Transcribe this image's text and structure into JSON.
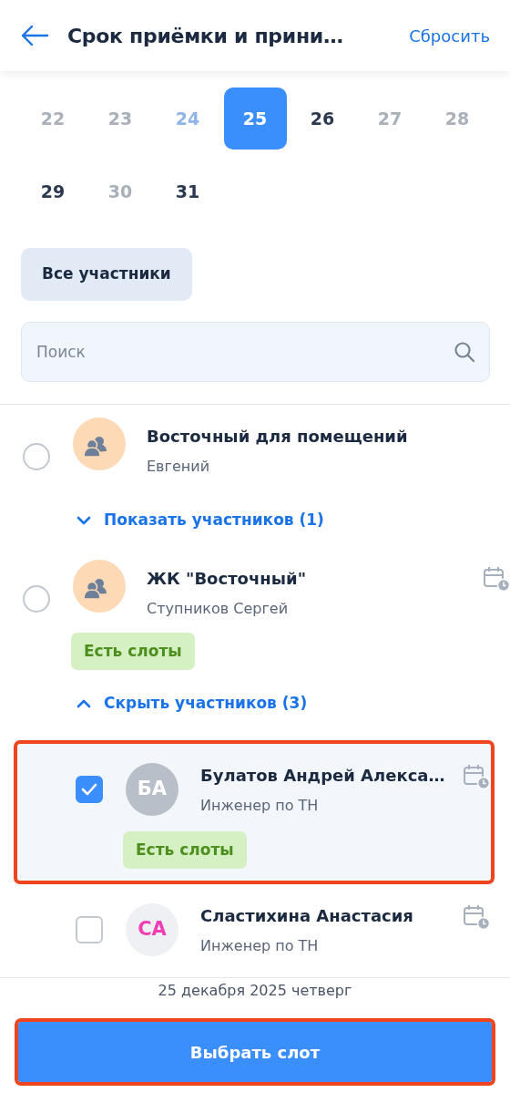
{
  "header": {
    "title": "Срок приёмки и прини…",
    "action": "Сбросить"
  },
  "calendar": {
    "weeks": [
      [
        {
          "label": "22",
          "disabled": true,
          "today": false,
          "selected": false
        },
        {
          "label": "23",
          "disabled": true,
          "today": false,
          "selected": false
        },
        {
          "label": "24",
          "disabled": true,
          "today": true,
          "selected": false
        },
        {
          "label": "25",
          "disabled": false,
          "today": false,
          "selected": true
        },
        {
          "label": "26",
          "disabled": false,
          "today": false,
          "selected": false
        },
        {
          "label": "27",
          "disabled": true,
          "today": false,
          "selected": false
        },
        {
          "label": "28",
          "disabled": true,
          "today": false,
          "selected": false
        }
      ],
      [
        {
          "label": "29",
          "disabled": false,
          "today": false,
          "selected": false
        },
        {
          "label": "30",
          "disabled": true,
          "today": false,
          "selected": false
        },
        {
          "label": "31",
          "disabled": false,
          "today": false,
          "selected": false
        }
      ]
    ]
  },
  "filter_button": "Все участники",
  "search": {
    "placeholder": "Поиск"
  },
  "groups": [
    {
      "title": "Восточный для помещений",
      "subtitle": "Евгений",
      "selected": false,
      "has_schedule": false,
      "toggle": "Показать участников (1)",
      "expanded": false
    },
    {
      "title": "ЖК \"Восточный\"",
      "subtitle": "Ступников Сергей",
      "selected": false,
      "has_schedule": true,
      "badge": "Есть слоты",
      "toggle": "Скрыть участников (3)",
      "expanded": true,
      "members": [
        {
          "initials": "БА",
          "color": "#ffffff",
          "name": "Булатов Андрей Алекса…",
          "role": "Инженер по ТН",
          "checked": true,
          "has_schedule": true,
          "badge": "Есть слоты",
          "highlighted": true
        },
        {
          "initials": "СА",
          "color": "#f03fb4",
          "name": "Сластихина Анастасия",
          "role": "Инженер по ТН",
          "checked": false,
          "has_schedule": true,
          "highlighted": false
        }
      ]
    }
  ],
  "footer": {
    "date": "25 декабря 2025 четверг",
    "button": "Выбрать слот",
    "highlighted": true
  }
}
